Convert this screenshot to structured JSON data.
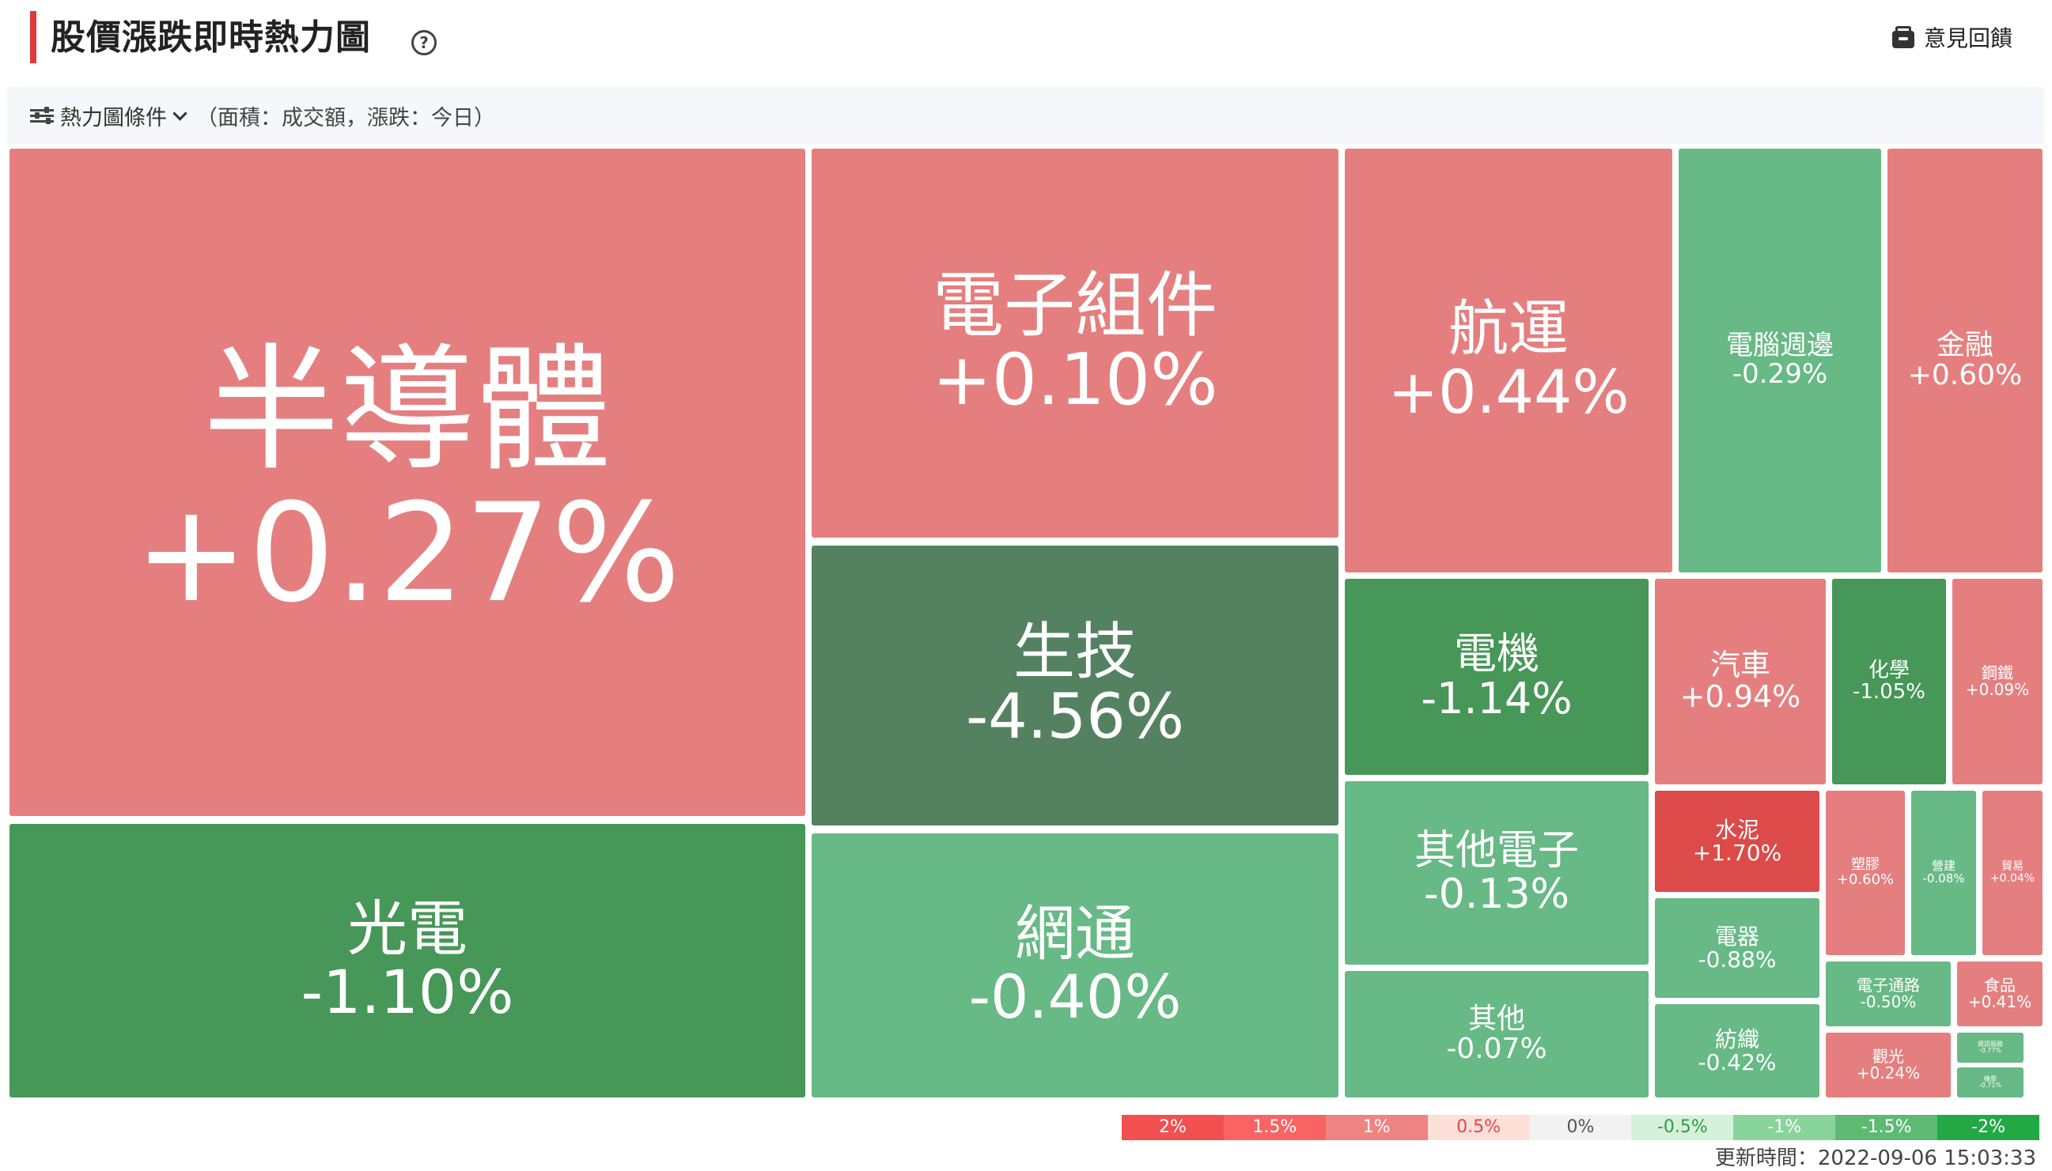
{
  "header": {
    "title": "股價漲跌即時熱力圖",
    "help_icon": "question-circle-icon",
    "feedback_label": "意見回饋",
    "feedback_icon": "inbox-icon"
  },
  "conditions": {
    "button_label": "熱力圖條件",
    "note": "（面積：成交額，漲跌：今日）",
    "icon": "sliders-icon"
  },
  "tiles": [
    {
      "name": "半導體",
      "change": "+0.27%",
      "color": "#e57f7f"
    },
    {
      "name": "光電",
      "change": "-1.10%",
      "color": "#479758"
    },
    {
      "name": "電子組件",
      "change": "+0.10%",
      "color": "#e57f7f"
    },
    {
      "name": "生技",
      "change": "-4.56%",
      "color": "#548260"
    },
    {
      "name": "網通",
      "change": "-0.40%",
      "color": "#67b985"
    },
    {
      "name": "航運",
      "change": "+0.44%",
      "color": "#e57f7f"
    },
    {
      "name": "電腦週邊",
      "change": "-0.29%",
      "color": "#67b985"
    },
    {
      "name": "金融",
      "change": "+0.60%",
      "color": "#e57f7f"
    },
    {
      "name": "電機",
      "change": "-1.14%",
      "color": "#479758"
    },
    {
      "name": "其他電子",
      "change": "-0.13%",
      "color": "#67b985"
    },
    {
      "name": "其他",
      "change": "-0.07%",
      "color": "#67b985"
    },
    {
      "name": "汽車",
      "change": "+0.94%",
      "color": "#e57f7f"
    },
    {
      "name": "化學",
      "change": "-1.05%",
      "color": "#479758"
    },
    {
      "name": "鋼鐵",
      "change": "+0.09%",
      "color": "#e57f7f"
    },
    {
      "name": "水泥",
      "change": "+1.70%",
      "color": "#dc4a4a"
    },
    {
      "name": "電器",
      "change": "-0.88%",
      "color": "#67b985"
    },
    {
      "name": "紡織",
      "change": "-0.42%",
      "color": "#67b985"
    },
    {
      "name": "塑膠",
      "change": "+0.60%",
      "color": "#e57f7f"
    },
    {
      "name": "營建",
      "change": "-0.08%",
      "color": "#67b985"
    },
    {
      "name": "貿易",
      "change": "+0.04%",
      "color": "#e57f7f"
    },
    {
      "name": "電子通路",
      "change": "-0.50%",
      "color": "#67b985"
    },
    {
      "name": "食品",
      "change": "+0.41%",
      "color": "#e57f7f"
    },
    {
      "name": "觀光",
      "change": "+0.24%",
      "color": "#e57f7f"
    },
    {
      "name": "資訊服務",
      "change": "-0.77%",
      "color": "#67b985"
    },
    {
      "name": "橡膠",
      "change": "-0.71%",
      "color": "#67b985"
    }
  ],
  "legend": [
    {
      "label": "2%",
      "bg": "#f24f4f",
      "fg": "#ffffff"
    },
    {
      "label": "1.5%",
      "bg": "#fa6363",
      "fg": "#ffffff"
    },
    {
      "label": "1%",
      "bg": "#ee8383",
      "fg": "#ffffff"
    },
    {
      "label": "0.5%",
      "bg": "#fde0d8",
      "fg": "#e04a4a"
    },
    {
      "label": "0%",
      "bg": "#f2f2f2",
      "fg": "#555555"
    },
    {
      "label": "-0.5%",
      "bg": "#d6f1d9",
      "fg": "#2e9a48"
    },
    {
      "label": "-1%",
      "bg": "#88d49b",
      "fg": "#ffffff"
    },
    {
      "label": "-1.5%",
      "bg": "#5dba73",
      "fg": "#ffffff"
    },
    {
      "label": "-2%",
      "bg": "#22a845",
      "fg": "#ffffff"
    }
  ],
  "updated": "更新時間：2022-09-06 15:03:33"
}
